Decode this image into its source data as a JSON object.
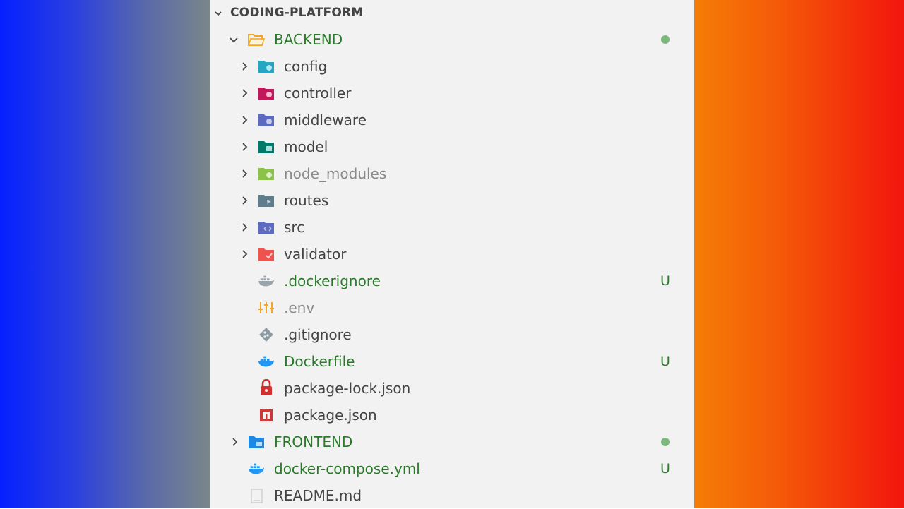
{
  "explorer": {
    "root": "CODING-PLATFORM",
    "backend": {
      "label": "BACKEND"
    },
    "backend_children": [
      {
        "label": "config",
        "icon": "config-folder-icon",
        "color": "#26a6c2"
      },
      {
        "label": "controller",
        "icon": "controller-folder-icon",
        "color": "#c2185b"
      },
      {
        "label": "middleware",
        "icon": "middleware-folder-icon",
        "color": "#5c6bc0"
      },
      {
        "label": "model",
        "icon": "model-folder-icon",
        "color": "#00796b"
      },
      {
        "label": "node_modules",
        "icon": "node-modules-folder-icon",
        "color": "#8bc34a"
      },
      {
        "label": "routes",
        "icon": "routes-folder-icon",
        "color": "#607d8b"
      },
      {
        "label": "src",
        "icon": "src-folder-icon",
        "color": "#5c6bc0"
      },
      {
        "label": "validator",
        "icon": "validator-folder-icon",
        "color": "#ef5350"
      }
    ],
    "backend_files": [
      {
        "label": ".dockerignore",
        "badge": "U"
      },
      {
        "label": ".env"
      },
      {
        "label": ".gitignore"
      },
      {
        "label": "Dockerfile",
        "badge": "U"
      },
      {
        "label": "package-lock.json"
      },
      {
        "label": "package.json"
      }
    ],
    "frontend": {
      "label": "FRONTEND"
    },
    "root_files": [
      {
        "label": "docker-compose.yml",
        "badge": "U"
      },
      {
        "label": "README.md"
      }
    ]
  }
}
